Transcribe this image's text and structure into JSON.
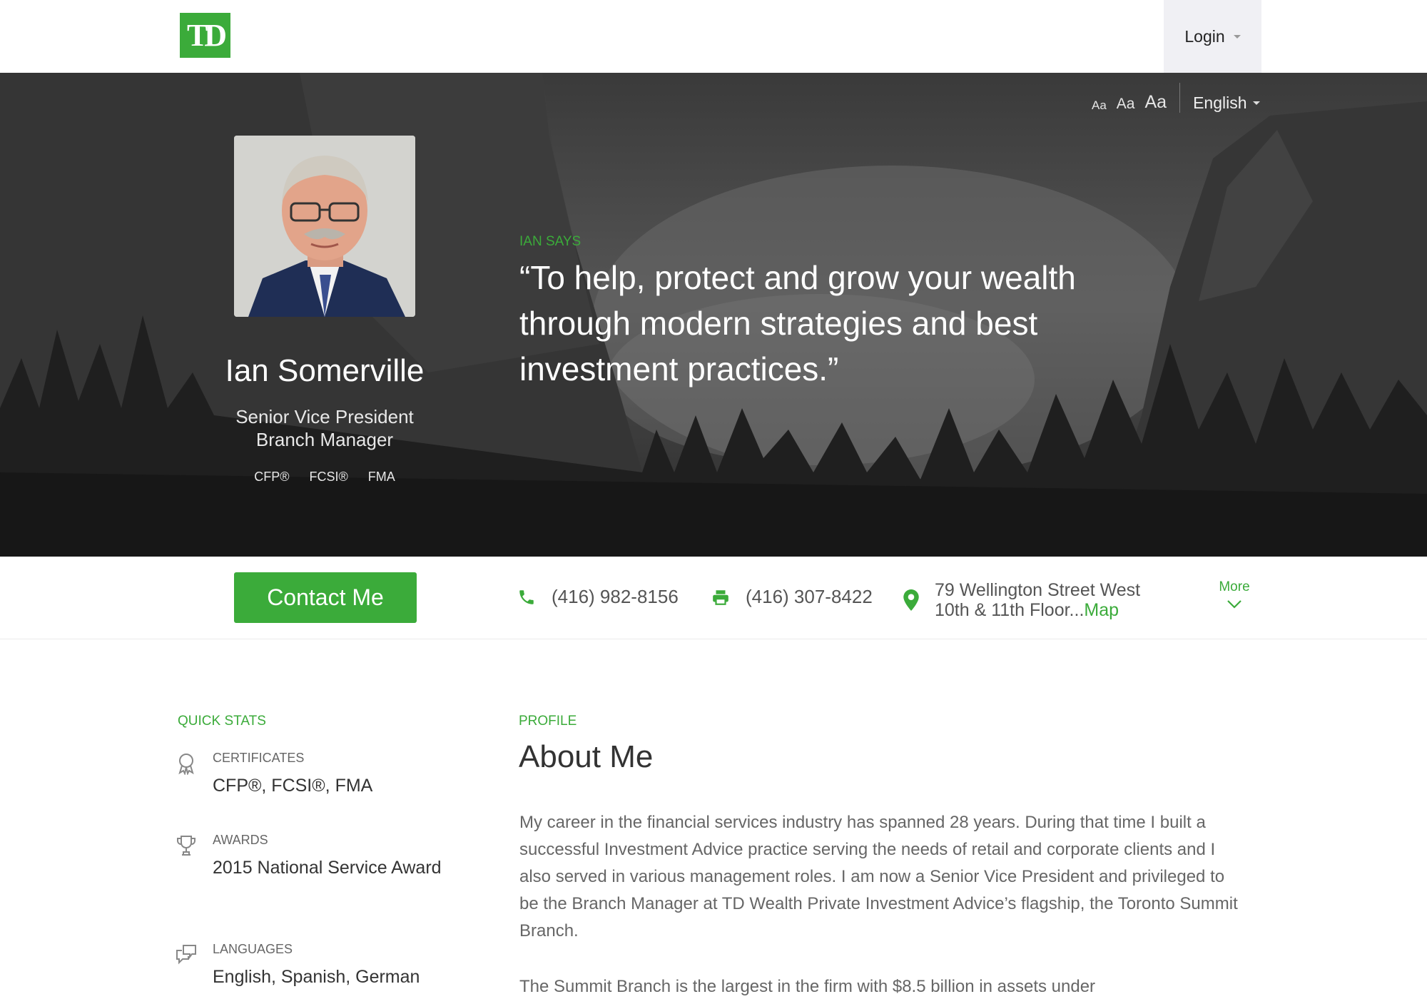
{
  "header": {
    "logo_text": "TD",
    "login_label": "Login"
  },
  "hero": {
    "font_size_options": [
      "Aa",
      "Aa",
      "Aa"
    ],
    "language": "English",
    "advisor_name": "Ian Somerville",
    "title_line1": "Senior Vice President",
    "title_line2": "Branch Manager",
    "credentials": [
      "CFP®",
      "FCSI®",
      "FMA"
    ],
    "says_label": "IAN SAYS",
    "quote": "“To help, protect and grow your wealth through modern strategies and best investment practices.”"
  },
  "contact": {
    "button_label": "Contact Me",
    "phone": "(416) 982-8156",
    "fax": "(416) 307-8422",
    "address_line1": "79 Wellington Street West",
    "address_line2": "10th & 11th Floor...",
    "map_label": "Map",
    "more_label": "More"
  },
  "quick_stats": {
    "heading": "QUICK STATS",
    "certificates_label": "CERTIFICATES",
    "certificates_value": "CFP®, FCSI®, FMA",
    "awards_label": "AWARDS",
    "awards_value": "2015 National Service Award",
    "languages_label": "LANGUAGES",
    "languages_value": "English, Spanish, German"
  },
  "profile": {
    "heading": "PROFILE",
    "title": "About Me",
    "paragraph1": "My career in the financial services industry has spanned 28 years. During that time I built a successful Investment Advice practice serving the needs of retail and corporate clients and I also served in various management roles. I am now a Senior Vice President and privileged to be the Branch Manager at TD Wealth Private Investment Advice’s flagship, the Toronto Summit Branch.",
    "paragraph2": "The Summit Branch is the largest in the firm with $8.5 billion in assets under"
  },
  "colors": {
    "brand_green": "#3bab3a",
    "login_bg": "#f0f0f4"
  }
}
